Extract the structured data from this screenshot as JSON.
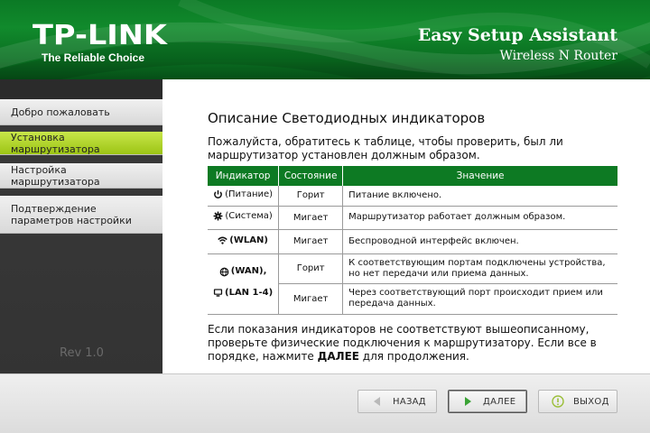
{
  "header": {
    "logo": "TP-LINK",
    "tagline": "The Reliable Choice",
    "title": "Easy Setup Assistant",
    "subtitle": "Wireless N Router"
  },
  "sidebar": {
    "items": [
      {
        "label": "Добро пожаловать",
        "active": false
      },
      {
        "label": "Установка маршрутизатора",
        "active": true
      },
      {
        "label": "Настройка маршрутизатора",
        "active": false
      },
      {
        "label": "Подтверждение параметров настройки",
        "active": false
      }
    ],
    "rev": "Rev 1.0"
  },
  "main": {
    "title": "Описание Светодиодных индикаторов",
    "intro": "Пожалуйста, обратитесь к таблице, чтобы проверить, был ли маршрутизатор установлен должным образом.",
    "table": {
      "headers": [
        "Индикатор",
        "Состояние",
        "Значение"
      ],
      "rows": [
        {
          "indicator": "(Питание)",
          "icon": "power-icon",
          "state": "Горит",
          "meaning": "Питание включено."
        },
        {
          "indicator": "(Система)",
          "icon": "gear-icon",
          "state": "Мигает",
          "meaning": "Маршрутизатор работает должным образом."
        },
        {
          "indicator": "(WLAN)",
          "icon": "wifi-icon",
          "state": "Мигает",
          "meaning": "Беспроводной интерфейс включен."
        },
        {
          "indicator": "(WAN),",
          "indicator2": "(LAN 1-4)",
          "icon": "globe-icon",
          "icon2": "monitor-icon",
          "state": "Горит",
          "meaning": "К соответствующим портам подключены устройства, но нет передачи или приема данных."
        },
        {
          "state": "Мигает",
          "meaning": "Через соответствующий порт происходит прием или передача данных."
        }
      ]
    },
    "outro_before": "Если показания индикаторов не соответствуют вышеописанному, проверьте физические подключения к маршрутизатору. Если все в порядке, нажмите ",
    "outro_bold": "ДАЛЕЕ",
    "outro_after": " для продолжения."
  },
  "footer": {
    "back_label": "НАЗАД",
    "next_label": "ДАЛЕЕ",
    "exit_label": "ВЫХОД"
  },
  "colors": {
    "brand_green": "#0d7a23",
    "active_item": "#b5d52e"
  }
}
